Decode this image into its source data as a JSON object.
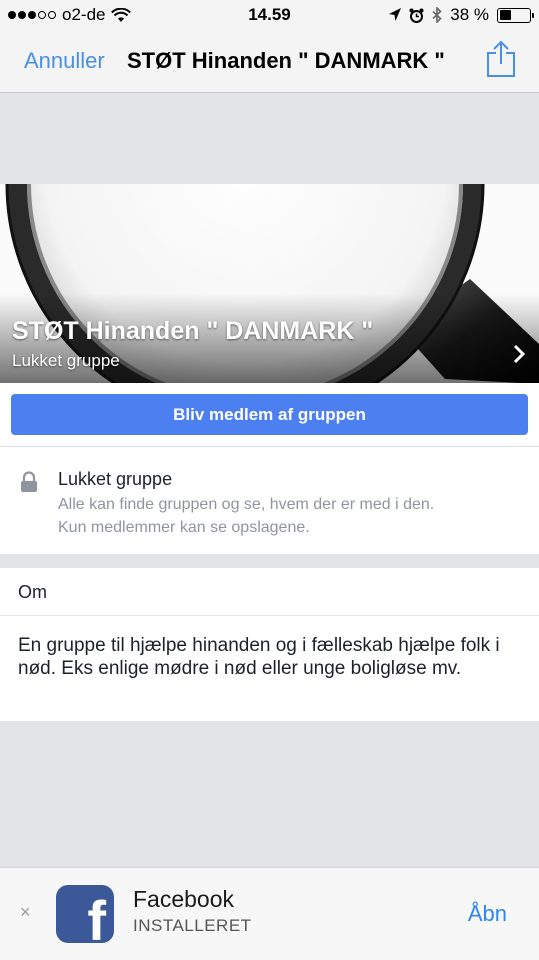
{
  "status_bar": {
    "carrier": "o2-de",
    "time": "14.59",
    "battery_percent": "38 %",
    "battery_level": 0.38,
    "signal_dots_filled": 3,
    "signal_dots_total": 5
  },
  "nav": {
    "cancel_label": "Annuller",
    "title": "STØT Hinanden \" DANMARK \""
  },
  "cover": {
    "group_name": "STØT Hinanden \" DANMARK \"",
    "group_type": "Lukket gruppe"
  },
  "join_button_label": "Bliv medlem af gruppen",
  "privacy": {
    "title": "Lukket gruppe",
    "description_line1": "Alle kan finde gruppen og se, hvem der er med i den.",
    "description_line2": "Kun medlemmer kan se opslagene."
  },
  "about": {
    "heading": "Om",
    "text": "En gruppe til hjælpe hinanden og i fælleskab hjælpe folk i nød. Eks enlige mødre i nød eller unge boligløse mv."
  },
  "app_banner": {
    "close_symbol": "×",
    "app_name": "Facebook",
    "status": "INSTALLERET",
    "open_label": "Åbn",
    "icon_letter": "f"
  },
  "colors": {
    "accent": "#4a90e2",
    "join_button": "#4c7ff0",
    "facebook_blue": "#3b5998"
  },
  "icons": [
    "wifi-icon",
    "location-icon",
    "alarm-icon",
    "bluetooth-icon",
    "battery-icon",
    "share-icon",
    "lock-icon",
    "chevron-right-icon",
    "close-icon",
    "facebook-app-icon"
  ]
}
